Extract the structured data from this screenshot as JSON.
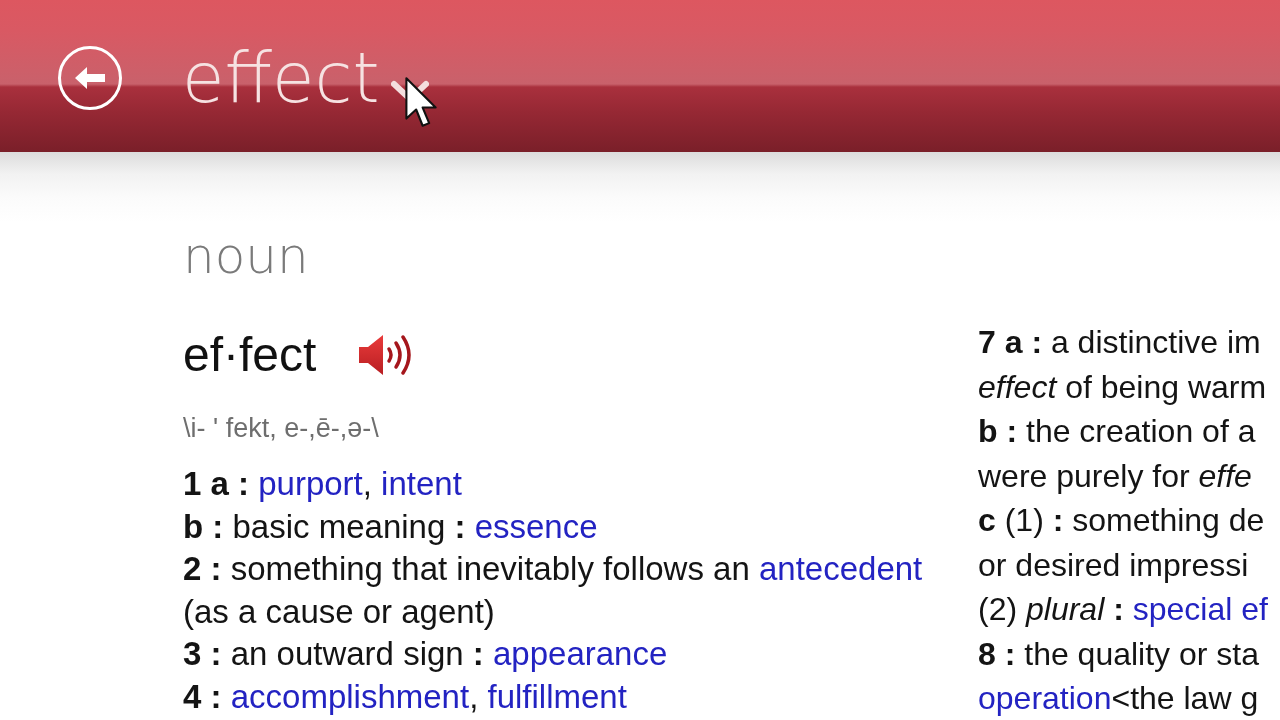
{
  "header": {
    "title": "effect"
  },
  "entry": {
    "part_of_speech": "noun",
    "headword": "ef·fect",
    "pronunciation": "\\i- ' fekt, e-,ē-,ə-\\",
    "senses": [
      {
        "parts": [
          {
            "kind": "label",
            "text": "1 a : "
          },
          {
            "kind": "link",
            "text": "purport"
          },
          {
            "kind": "text",
            "text": ", "
          },
          {
            "kind": "link",
            "text": "intent"
          }
        ]
      },
      {
        "parts": [
          {
            "kind": "label",
            "text": "b : "
          },
          {
            "kind": "text",
            "text": "basic meaning "
          },
          {
            "kind": "label",
            "text": ": "
          },
          {
            "kind": "link",
            "text": "essence"
          }
        ]
      },
      {
        "parts": [
          {
            "kind": "label",
            "text": "2 : "
          },
          {
            "kind": "text",
            "text": "something that inevitably follows an "
          },
          {
            "kind": "link",
            "text": "antecedent"
          },
          {
            "kind": "text",
            "text": " (as a cause or agent)"
          }
        ]
      },
      {
        "parts": [
          {
            "kind": "label",
            "text": "3 : "
          },
          {
            "kind": "text",
            "text": "an outward sign "
          },
          {
            "kind": "label",
            "text": ": "
          },
          {
            "kind": "link",
            "text": "appearance"
          }
        ]
      },
      {
        "parts": [
          {
            "kind": "label",
            "text": "4 : "
          },
          {
            "kind": "link",
            "text": "accomplishment"
          },
          {
            "kind": "text",
            "text": ", "
          },
          {
            "kind": "link",
            "text": "fulfillment"
          }
        ]
      }
    ]
  },
  "right_column_lines": [
    {
      "parts": [
        {
          "kind": "label",
          "text": "7 a : "
        },
        {
          "kind": "text",
          "text": "a distinctive im"
        }
      ]
    },
    {
      "parts": [
        {
          "kind": "italic",
          "text": "effect"
        },
        {
          "kind": "text",
          "text": " of being warm"
        }
      ]
    },
    {
      "parts": [
        {
          "kind": "label",
          "text": "b : "
        },
        {
          "kind": "text",
          "text": "the creation of a"
        }
      ]
    },
    {
      "parts": [
        {
          "kind": "text",
          "text": "were purely for "
        },
        {
          "kind": "italic",
          "text": "effe"
        }
      ]
    },
    {
      "parts": [
        {
          "kind": "label",
          "text": "c "
        },
        {
          "kind": "text",
          "text": "(1) "
        },
        {
          "kind": "label",
          "text": ": "
        },
        {
          "kind": "text",
          "text": "something de"
        }
      ]
    },
    {
      "parts": [
        {
          "kind": "text",
          "text": "or desired impressi"
        }
      ]
    },
    {
      "parts": [
        {
          "kind": "text",
          "text": "(2) "
        },
        {
          "kind": "italic",
          "text": "plural"
        },
        {
          "kind": "label",
          "text": " : "
        },
        {
          "kind": "link",
          "text": "special ef"
        }
      ]
    },
    {
      "parts": [
        {
          "kind": "label",
          "text": "8 : "
        },
        {
          "kind": "text",
          "text": "the quality or sta"
        }
      ]
    },
    {
      "parts": [
        {
          "kind": "link",
          "text": "operation"
        },
        {
          "kind": "text",
          "text": "<the law g"
        }
      ]
    }
  ]
}
